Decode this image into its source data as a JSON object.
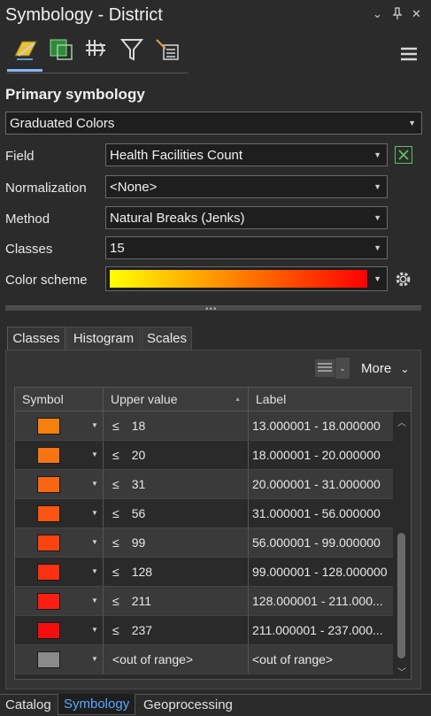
{
  "window": {
    "title": "Symbology - District",
    "controls": [
      "⌄",
      "⇱",
      "✕"
    ]
  },
  "toolbar": {
    "icons": [
      "primary-symbology-icon",
      "secondary-symbology-icon",
      "vary-symbology-icon",
      "symbol-classes-icon",
      "symbol-layer-drawing-icon"
    ]
  },
  "section": {
    "title": "Primary symbology"
  },
  "symbology_type": {
    "value": "Graduated Colors"
  },
  "fields": {
    "field": {
      "label": "Field",
      "value": "Health Facilities Count"
    },
    "normalization": {
      "label": "Normalization",
      "value": "<None>"
    },
    "method": {
      "label": "Method",
      "value": "Natural Breaks (Jenks)"
    },
    "classes": {
      "label": "Classes",
      "value": "15"
    },
    "color_scheme": {
      "label": "Color scheme",
      "gradient_start": "#ffff00",
      "gradient_end": "#ff0000"
    }
  },
  "tabs": [
    "Classes",
    "Histogram",
    "Scales"
  ],
  "more_label": "More",
  "table": {
    "headers": {
      "symbol": "Symbol",
      "upper": "Upper value",
      "label": "Label"
    },
    "rows": [
      {
        "color": "#f5800c",
        "op": "≤",
        "upper": "18",
        "label": "13.000001 - 18.000000"
      },
      {
        "color": "#f77414",
        "op": "≤",
        "upper": "20",
        "label": "18.000001 - 20.000000"
      },
      {
        "color": "#f86612",
        "op": "≤",
        "upper": "31",
        "label": "20.000001 - 31.000000"
      },
      {
        "color": "#f95410",
        "op": "≤",
        "upper": "56",
        "label": "31.000001 - 56.000000"
      },
      {
        "color": "#fa4410",
        "op": "≤",
        "upper": "99",
        "label": "56.000001 - 99.000000"
      },
      {
        "color": "#fb3010",
        "op": "≤",
        "upper": "128",
        "label": "99.000001 - 128.000000"
      },
      {
        "color": "#fc1e10",
        "op": "≤",
        "upper": "211",
        "label": "128.000001 - 211.000..."
      },
      {
        "color": "#f40e0e",
        "op": "≤",
        "upper": "237",
        "label": "211.000001 - 237.000..."
      },
      {
        "color": "#8a8a8a",
        "op": "",
        "upper": "<out of range>",
        "label": "<out of range>"
      }
    ]
  },
  "bottom_tabs": [
    "Catalog",
    "Symbology",
    "Geoprocessing"
  ]
}
